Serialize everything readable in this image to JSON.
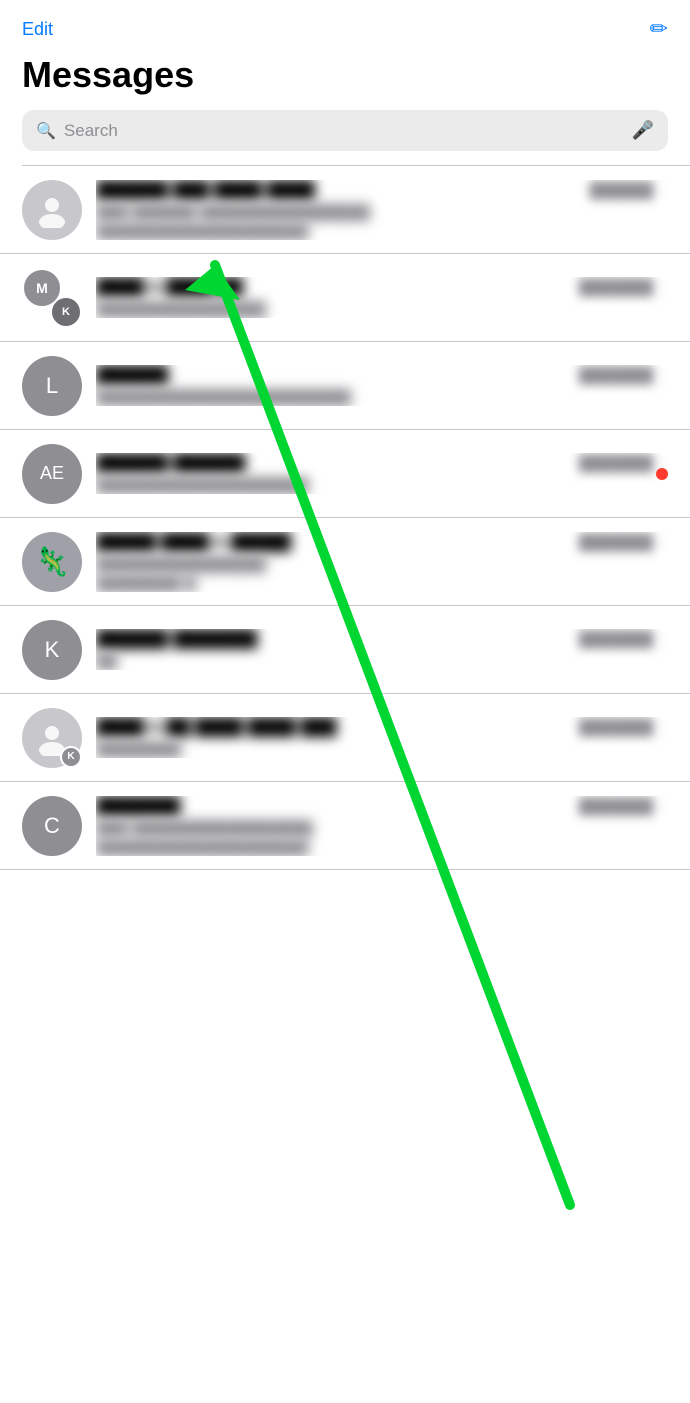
{
  "header": {
    "edit_label": "Edit",
    "title": "Messages"
  },
  "search": {
    "placeholder": "Search"
  },
  "messages": [
    {
      "id": 1,
      "avatar_type": "person_icon",
      "initials": "",
      "name": "██████ ███ ████",
      "time": "██████",
      "preview": "███ ██████ ████████████████",
      "preview2": "████████████████████",
      "has_notification": false
    },
    {
      "id": 2,
      "avatar_type": "dual",
      "initials_1": "M",
      "initials_2": "K",
      "name": "████ & █████",
      "time": "███████",
      "preview": "████████████████",
      "preview2": "",
      "has_notification": false
    },
    {
      "id": 3,
      "avatar_type": "initial",
      "initials": "L",
      "name": "██████",
      "time": "███████",
      "preview": "████████████████████████",
      "preview2": "",
      "has_notification": false
    },
    {
      "id": 4,
      "avatar_type": "initial",
      "initials": "AE",
      "name": "██████ ██████",
      "time": "███████",
      "preview": "████████████████████",
      "preview2": "",
      "has_notification": true
    },
    {
      "id": 5,
      "avatar_type": "image",
      "initials": "🦎",
      "name": "█████ ████ & █████",
      "time": "███████",
      "preview": "████████████████",
      "preview2": "████████ █",
      "has_notification": false
    },
    {
      "id": 6,
      "avatar_type": "initial",
      "initials": "K",
      "name": "██████ ███████",
      "time": "███████",
      "preview": "██",
      "preview2": "",
      "has_notification": false
    },
    {
      "id": 7,
      "avatar_type": "person_badge",
      "initials": "",
      "badge_initial": "K",
      "name": "████ & ██ ████ ████ ███",
      "time": "███████",
      "preview": "████████",
      "preview2": "",
      "has_notification": false
    },
    {
      "id": 8,
      "avatar_type": "initial",
      "initials": "C",
      "name": "███████",
      "time": "███████",
      "preview": "███ █████████████████",
      "preview2": "████████████████████",
      "has_notification": false
    }
  ]
}
